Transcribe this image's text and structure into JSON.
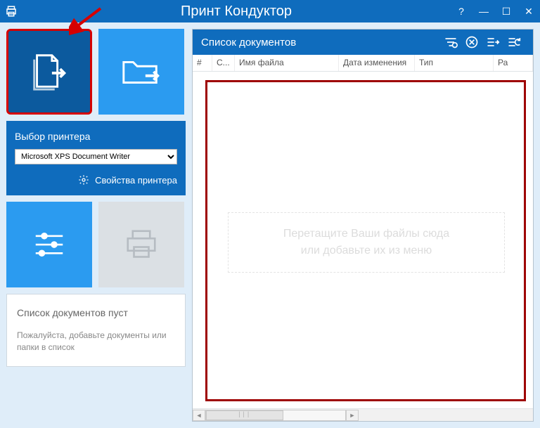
{
  "titlebar": {
    "title": "Принт Кондуктор"
  },
  "printer": {
    "label": "Выбор принтера",
    "selected": "Microsoft XPS Document Writer",
    "properties": "Свойства принтера"
  },
  "status": {
    "title": "Список документов пуст",
    "message": "Пожалуйста, добавьте документы или папки в список"
  },
  "docs": {
    "title": "Список документов",
    "columns": {
      "num": "#",
      "status": "С...",
      "filename": "Имя файла",
      "modified": "Дата изменения",
      "type": "Тип",
      "size": "Ра"
    },
    "drop_hint_line1": "Перетащите Ваши файлы сюда",
    "drop_hint_line2": "или добавьте их из меню"
  }
}
